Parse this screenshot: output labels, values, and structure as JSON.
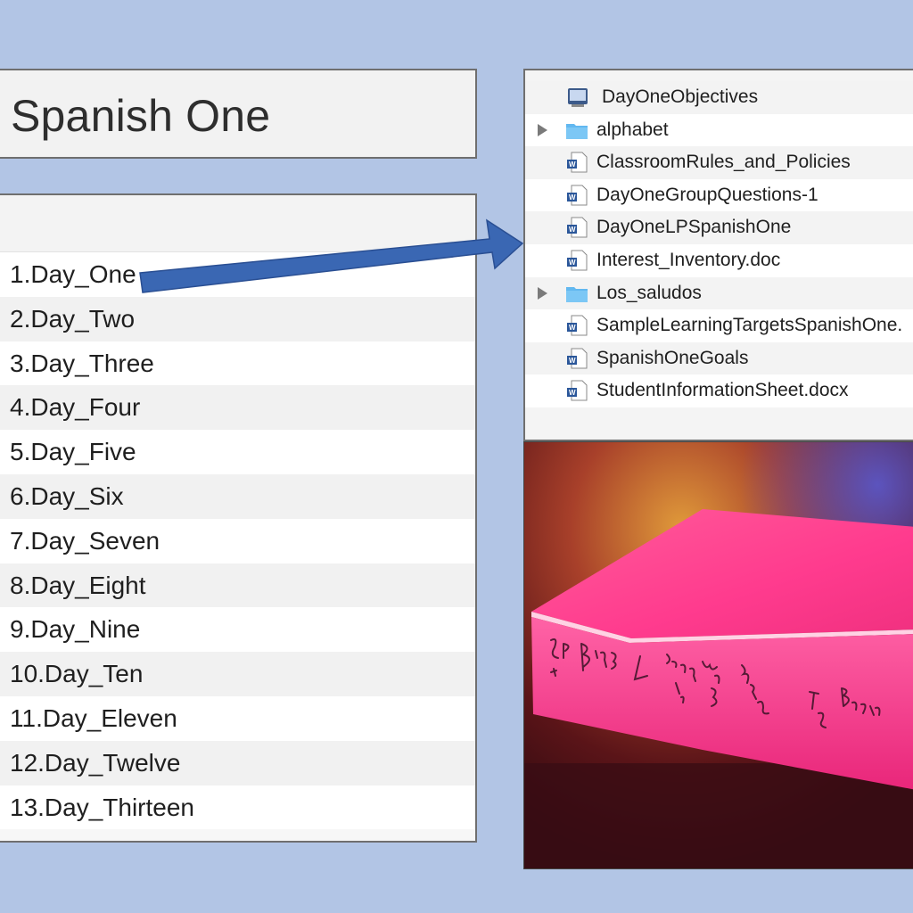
{
  "title": "Spanish One",
  "days": [
    "1.Day_One",
    "2.Day_Two",
    "3.Day_Three",
    "4.Day_Four",
    "5.Day_Five",
    "6.Day_Six",
    "7.Day_Seven",
    "8.Day_Eight",
    "9.Day_Nine",
    "10.Day_Ten",
    "11.Day_Eleven",
    "12.Day_Twelve",
    "13.Day_Thirteen"
  ],
  "files": [
    {
      "name": "DayOneObjectives",
      "icon": "slides-file-icon"
    },
    {
      "name": "alphabet",
      "icon": "folder-icon"
    },
    {
      "name": "ClassroomRules_and_Policies",
      "icon": "word-doc-icon"
    },
    {
      "name": "DayOneGroupQuestions-1",
      "icon": "word-doc-icon"
    },
    {
      "name": "DayOneLPSpanishOne",
      "icon": "word-doc-icon"
    },
    {
      "name": "Interest_Inventory.doc",
      "icon": "word-doc-icon"
    },
    {
      "name": "Los_saludos",
      "icon": "folder-icon"
    },
    {
      "name": "SampleLearningTargetsSpanishOne.",
      "icon": "word-doc-icon"
    },
    {
      "name": "SpanishOneGoals",
      "icon": "word-doc-icon"
    },
    {
      "name": "StudentInformationSheet.docx",
      "icon": "word-doc-icon"
    }
  ],
  "binder_photo": {
    "handwritten_label": [
      "SP 3",
      "Binder",
      "4",
      "commands",
      "tú",
      "ud/uds",
      "nosotros",
      "To",
      "Become"
    ]
  },
  "colors": {
    "background": "#b2c5e5",
    "arrow": "#3a67b3",
    "folder": "#62b8f0",
    "word_blue": "#2b579a",
    "binder_pink": "#ff2f86"
  }
}
